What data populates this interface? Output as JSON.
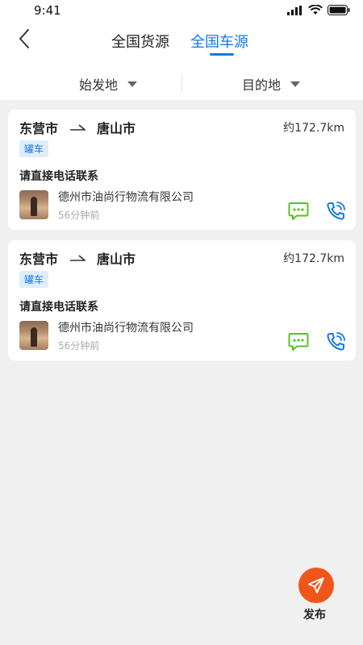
{
  "status_bar": {
    "time": "9:41"
  },
  "nav": {
    "tabs": [
      {
        "label": "全国货源",
        "active": false
      },
      {
        "label": "全国车源",
        "active": true
      }
    ]
  },
  "filters": {
    "start_label": "始发地",
    "dest_label": "目的地"
  },
  "listings": [
    {
      "origin": "东营市",
      "destination": "唐山市",
      "distance": "约172.7km",
      "tag": "罐车",
      "contact_title": "请直接电话联系",
      "company": "德州市油尚行物流有限公司",
      "posted": "56分钟前"
    },
    {
      "origin": "东营市",
      "destination": "唐山市",
      "distance": "约172.7km",
      "tag": "罐车",
      "contact_title": "请直接电话联系",
      "company": "德州市油尚行物流有限公司",
      "posted": "56分钟前"
    }
  ],
  "fab": {
    "label": "发布"
  },
  "colors": {
    "accent": "#1677e6",
    "message": "#52c41a",
    "publish": "#f0561a",
    "background": "#f0f0f0"
  },
  "icons": {
    "back": "chevron-left",
    "message": "chat-bubble",
    "call": "phone",
    "publish": "paper-plane"
  }
}
